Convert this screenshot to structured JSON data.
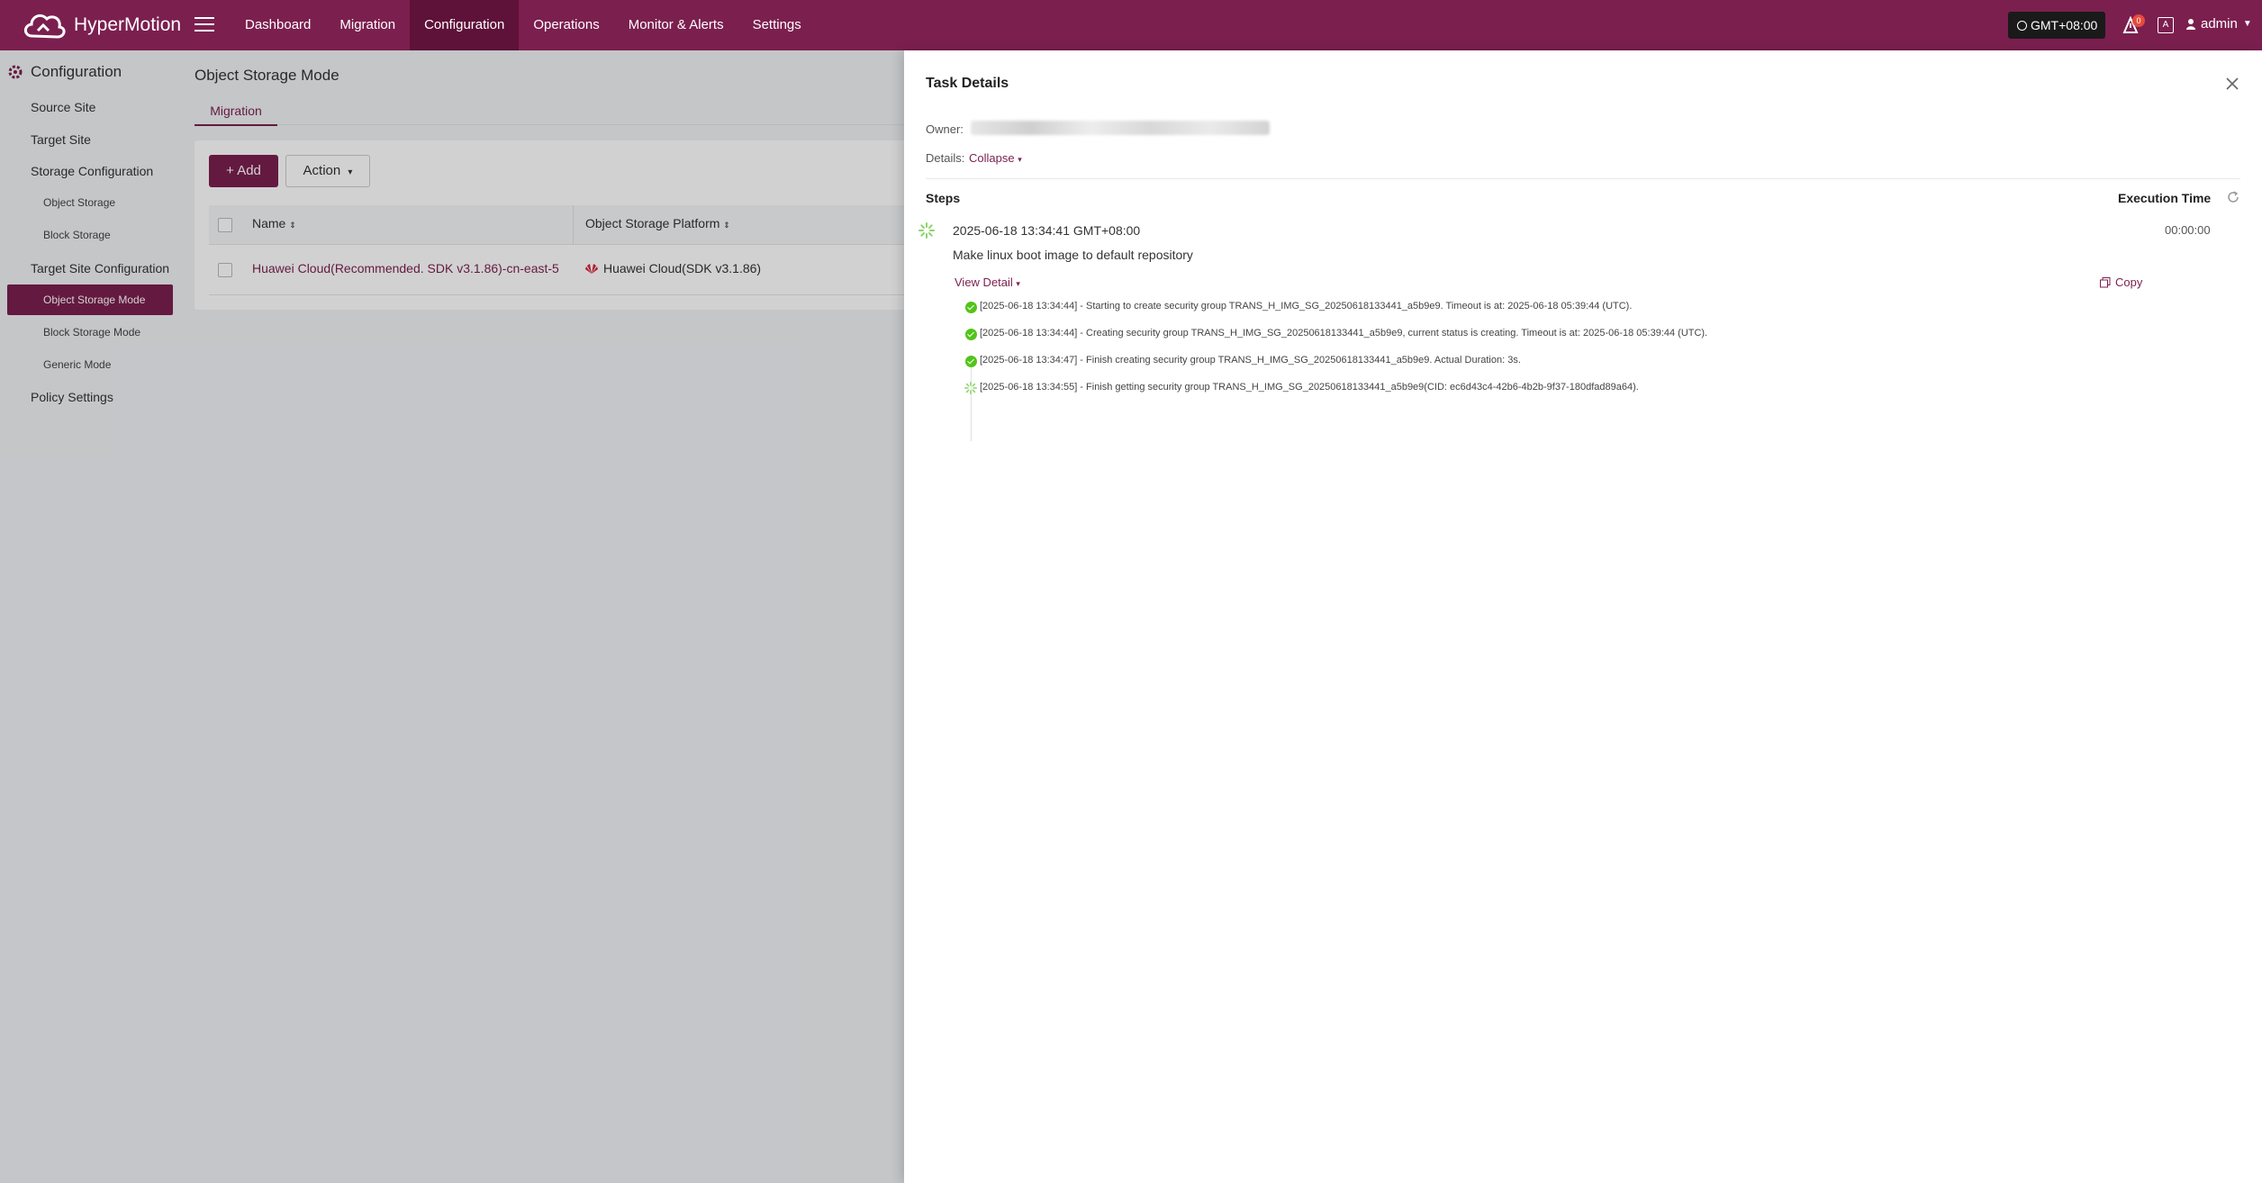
{
  "app": {
    "brand": "HyperMotion"
  },
  "nav": {
    "items": [
      "Dashboard",
      "Migration",
      "Configuration",
      "Operations",
      "Monitor & Alerts",
      "Settings"
    ],
    "active": "Configuration"
  },
  "header": {
    "timezone": "GMT+08:00",
    "alerts_count": "0",
    "lang_icon": "A",
    "user": "admin"
  },
  "sidebar": {
    "title": "Configuration",
    "source_site": "Source Site",
    "target_site": "Target Site",
    "storage_configuration": "Storage Configuration",
    "object_storage": "Object Storage",
    "block_storage": "Block Storage",
    "target_site_configuration": "Target Site Configuration",
    "object_storage_mode": "Object Storage Mode",
    "block_storage_mode": "Block Storage Mode",
    "generic_mode": "Generic Mode",
    "policy_settings": "Policy Settings"
  },
  "main": {
    "title": "Object Storage Mode",
    "tab": "Migration",
    "add_label": "+ Add",
    "action_label": "Action",
    "columns": {
      "name": "Name",
      "platform": "Object Storage Platform"
    },
    "rows": [
      {
        "name": "Huawei Cloud(Recommended. SDK v3.1.86)-cn-east-5",
        "platform": "Huawei Cloud(SDK v3.1.86)"
      }
    ]
  },
  "drawer": {
    "title": "Task Details",
    "owner_label": "Owner:",
    "details_label": "Details:",
    "collapse_label": "Collapse",
    "steps_label": "Steps",
    "exec_time_label": "Execution Time",
    "step": {
      "time": "2025-06-18 13:34:41 GMT+08:00",
      "duration": "00:00:00",
      "description": "Make linux boot image to default repository",
      "view_detail": "View Detail",
      "copy_label": "Copy"
    },
    "logs": [
      "[2025-06-18 13:34:44] - Starting to create security group TRANS_H_IMG_SG_20250618133441_a5b9e9. Timeout is at: 2025-06-18 05:39:44 (UTC).",
      "[2025-06-18 13:34:44] - Creating security group TRANS_H_IMG_SG_20250618133441_a5b9e9, current status is creating. Timeout is at: 2025-06-18 05:39:44 (UTC).",
      "[2025-06-18 13:34:47] - Finish creating security group TRANS_H_IMG_SG_20250618133441_a5b9e9. Actual Duration: 3s.",
      "[2025-06-18 13:34:55] - Finish getting security group TRANS_H_IMG_SG_20250618133441_a5b9e9(CID: ec6d43c4-42b6-4b2b-9f37-180dfad89a64)."
    ]
  },
  "colors": {
    "brand": "#7b1f4f",
    "brand_dark": "#5e1139",
    "success": "#52c41a"
  }
}
